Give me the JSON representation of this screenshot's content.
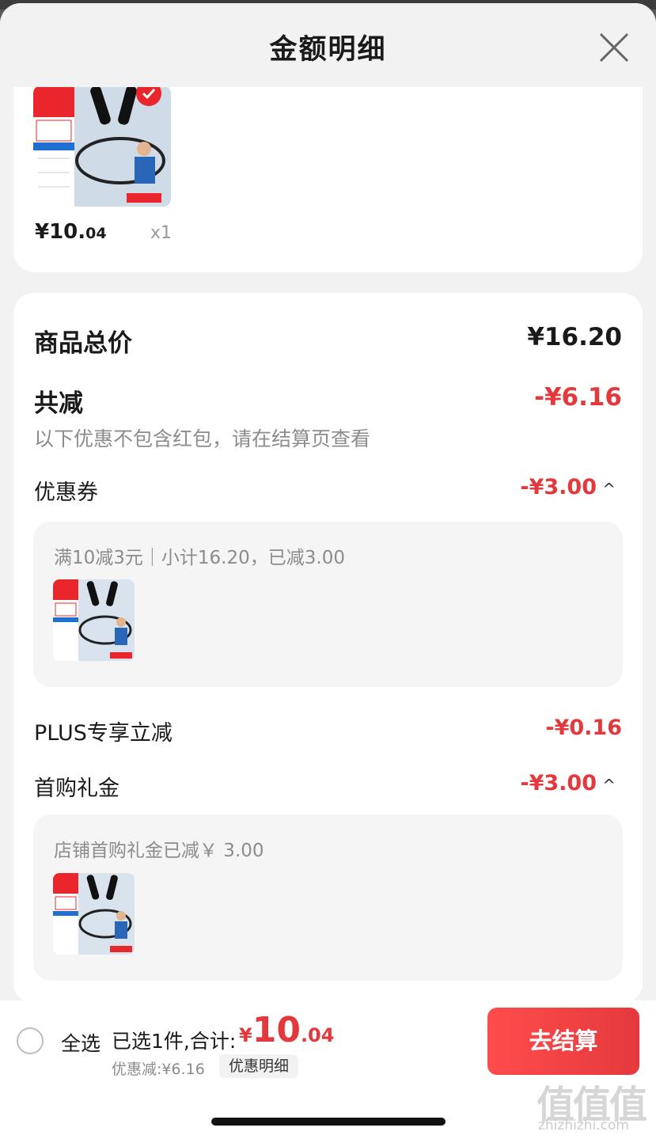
{
  "header": {
    "title": "金额明细"
  },
  "product": {
    "price_int": "¥10.",
    "price_dec": "04",
    "quantity": "x1"
  },
  "detail": {
    "total_label": "商品总价",
    "total_value": "¥16.20",
    "reduce_label": "共减",
    "reduce_value": "-¥6.16",
    "note": "以下优惠不包含红包，请在结算页查看",
    "coupon": {
      "label": "优惠券",
      "value": "-¥3.00",
      "caret": "^",
      "box_text": "满10减3元｜小计16.20，已减3.00"
    },
    "plus": {
      "label": "PLUS专享立减",
      "value": "-¥0.16"
    },
    "firstbuy": {
      "label": "首购礼金",
      "value": "-¥3.00",
      "caret": "^",
      "box_text": "店铺首购礼金已减￥ 3.00"
    }
  },
  "bottom": {
    "select_all": "全选",
    "summary": "已选1件,合计:",
    "total_yen": "¥",
    "total_int": "10",
    "total_dec": ".04",
    "discount": "优惠减:¥6.16",
    "detail_link": "优惠明细",
    "checkout": "去结算"
  },
  "watermark": {
    "main": "值值值",
    "sub": "zhizhizhi.com"
  },
  "colors": {
    "accent": "#e4393c",
    "background": "#f2f2f2",
    "card": "#ffffff"
  }
}
